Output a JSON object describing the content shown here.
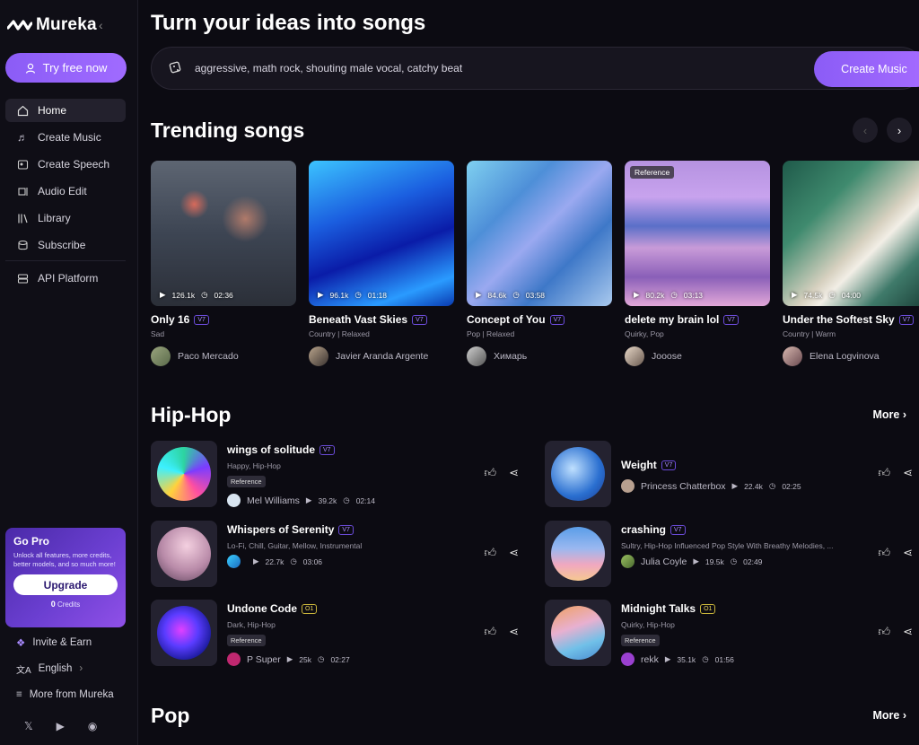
{
  "brand": {
    "name": "Mureka"
  },
  "sidebar": {
    "try_label": "Try free now",
    "items": [
      {
        "label": "Home",
        "icon": "home-icon",
        "active": true
      },
      {
        "label": "Create Music",
        "icon": "music-note-icon"
      },
      {
        "label": "Create Speech",
        "icon": "speech-icon"
      },
      {
        "label": "Audio Edit",
        "icon": "audio-edit-icon"
      },
      {
        "label": "Library",
        "icon": "library-icon"
      },
      {
        "label": "Subscribe",
        "icon": "subscribe-icon"
      },
      {
        "label": "API Platform",
        "icon": "api-icon"
      }
    ],
    "gopro": {
      "title": "Go Pro",
      "desc": "Unlock all features, more credits, better models, and so much more!",
      "upgrade": "Upgrade",
      "credits_num": "0",
      "credits_label": "Credits"
    },
    "bottom": [
      {
        "label": "Invite & Earn",
        "icon": "gift-icon"
      },
      {
        "label": "English",
        "icon": "translate-icon"
      },
      {
        "label": "More from Mureka",
        "icon": "menu-icon"
      }
    ],
    "socials": [
      "x-icon",
      "youtube-icon",
      "discord-icon"
    ]
  },
  "hero": {
    "title": "Turn your ideas into songs",
    "prompt": "aggressive, math rock, shouting male vocal, catchy beat",
    "create_label": "Create Music"
  },
  "trending": {
    "title": "Trending songs",
    "songs": [
      {
        "title": "Only 16",
        "badge": "V7",
        "tags": "Sad",
        "plays": "126.1k",
        "duration": "02:36",
        "user": "Paco Mercado",
        "reference": ""
      },
      {
        "title": "Beneath Vast Skies",
        "badge": "V7",
        "tags": "Country | Relaxed",
        "plays": "96.1k",
        "duration": "01:18",
        "user": "Javier Aranda Argente",
        "reference": ""
      },
      {
        "title": "Concept of You",
        "badge": "V7",
        "tags": "Pop | Relaxed",
        "plays": "84.6k",
        "duration": "03:58",
        "user": "Химарь",
        "reference": ""
      },
      {
        "title": "delete my brain lol",
        "badge": "V7",
        "tags": "Quirky, Pop",
        "plays": "80.2k",
        "duration": "03:13",
        "user": "Jooose",
        "reference": "Reference"
      },
      {
        "title": "Under the Softest Sky",
        "badge": "V7",
        "tags": "Country | Warm",
        "plays": "74.5k",
        "duration": "04:00",
        "user": "Elena Logvinova",
        "reference": ""
      }
    ]
  },
  "hiphop": {
    "title": "Hip-Hop",
    "more": "More",
    "songs": [
      {
        "title": "wings of solitude",
        "badge": "V7",
        "tags": "Happy, Hip-Hop",
        "reference": "Reference",
        "user": "Mel Williams",
        "plays": "39.2k",
        "duration": "02:14"
      },
      {
        "title": "Weight",
        "badge": "V7",
        "tags": "",
        "reference": "",
        "user": "Princess Chatterbox",
        "plays": "22.4k",
        "duration": "02:25"
      },
      {
        "title": "Whispers of Serenity",
        "badge": "V7",
        "tags": "Lo-Fi, Chill, Guitar, Mellow, Instrumental",
        "reference": "",
        "user": "",
        "plays": "22.7k",
        "duration": "03:06"
      },
      {
        "title": "crashing",
        "badge": "V7",
        "tags": "Sultry, Hip-Hop Influenced Pop Style With Breathy Melodies, ...",
        "reference": "",
        "user": "Julia Coyle",
        "plays": "19.5k",
        "duration": "02:49"
      },
      {
        "title": "Undone Code",
        "badge": "O1",
        "tags": "Dark, Hip-Hop",
        "reference": "Reference",
        "user": "P Super",
        "plays": "25k",
        "duration": "02:27"
      },
      {
        "title": "Midnight Talks",
        "badge": "O1",
        "tags": "Quirky, Hip-Hop",
        "reference": "Reference",
        "user": "rekk",
        "plays": "35.1k",
        "duration": "01:56"
      }
    ]
  },
  "pop": {
    "title": "Pop",
    "more": "More"
  },
  "colors": {
    "accent": "#8b5cf6",
    "bg": "#0c0b12"
  }
}
